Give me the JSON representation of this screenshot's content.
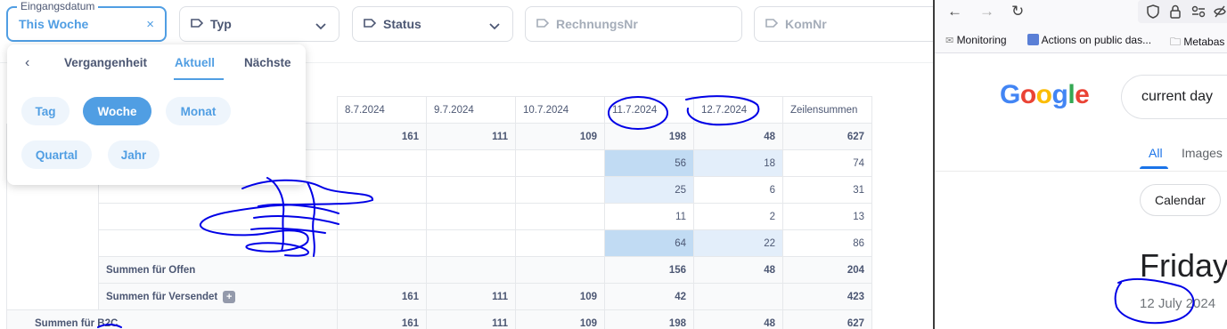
{
  "filters": {
    "date": {
      "legend": "Eingangsdatum",
      "value": "This Woche",
      "clear": "×"
    },
    "typ": {
      "label": "Typ"
    },
    "status": {
      "label": "Status"
    },
    "rechnungsnr": {
      "placeholder": "RechnungsNr"
    },
    "komnr": {
      "placeholder": "KomNr"
    }
  },
  "popover": {
    "back": "‹",
    "tabs": [
      "Vergangenheit",
      "Aktuell",
      "Nächste"
    ],
    "active_tab": "Aktuell",
    "options": [
      "Tag",
      "Woche",
      "Monat",
      "Quartal",
      "Jahr"
    ],
    "selected": "Woche"
  },
  "table": {
    "columns": [
      "8.7.2024",
      "9.7.2024",
      "10.7.2024",
      "11.7.2024",
      "12.7.2024",
      "Zeilensummen"
    ],
    "total_row": [
      "161",
      "111",
      "109",
      "198",
      "48",
      "627"
    ],
    "rows": [
      [
        "",
        "",
        "",
        "56",
        "18",
        "74"
      ],
      [
        "",
        "",
        "",
        "25",
        "6",
        "31"
      ],
      [
        "",
        "",
        "",
        "11",
        "2",
        "13"
      ],
      [
        "",
        "",
        "",
        "64",
        "22",
        "86"
      ]
    ],
    "sum_offen": {
      "label": "Summen für Offen",
      "values": [
        "",
        "",
        "",
        "156",
        "48",
        "204"
      ]
    },
    "sum_versendet": {
      "label": "Summen für Versendet",
      "plus": "+",
      "values": [
        "161",
        "111",
        "109",
        "42",
        "",
        "423"
      ]
    },
    "sum_b2c": {
      "label": "Summen für B2C",
      "values": [
        "161",
        "111",
        "109",
        "198",
        "48",
        "627"
      ]
    }
  },
  "browser": {
    "nav": {
      "back": "←",
      "forward": "→",
      "reload": "↻"
    },
    "bookmarks": [
      "Monitoring",
      "Actions on public das...",
      "Metabas"
    ],
    "google_logo": "Google",
    "search_query": "current day",
    "tabs": [
      "All",
      "Images"
    ],
    "active_tab": "All",
    "chips": [
      "Calendar"
    ],
    "result_day": "Friday",
    "result_date": "12 July 2024"
  },
  "colors": {
    "accent": "#509ee3",
    "highlight_strong": "#c1dbf3",
    "highlight_light": "#e3eefa",
    "scribble": "#0000e6"
  }
}
